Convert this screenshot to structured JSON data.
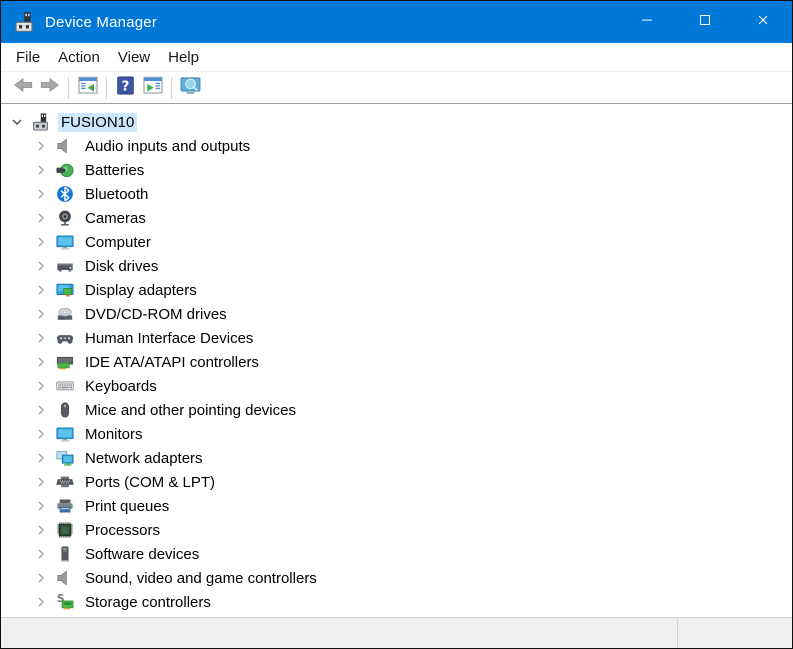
{
  "window": {
    "title": "Device Manager",
    "icon": "device-manager-icon",
    "controls": [
      {
        "name": "minimize",
        "icon": "minimize-icon"
      },
      {
        "name": "maximize",
        "icon": "maximize-icon"
      },
      {
        "name": "close",
        "icon": "close-icon"
      }
    ]
  },
  "menu_bar": {
    "items": [
      {
        "label": "File"
      },
      {
        "label": "Action"
      },
      {
        "label": "View"
      },
      {
        "label": "Help"
      }
    ]
  },
  "toolbar": {
    "buttons": [
      {
        "name": "back",
        "icon": "back-arrow-icon",
        "disabled": true
      },
      {
        "name": "forward",
        "icon": "forward-arrow-icon",
        "disabled": true
      },
      {
        "name": "show-console-tree",
        "icon": "console-tree-icon"
      },
      {
        "name": "help",
        "icon": "help-icon"
      },
      {
        "name": "export-list",
        "icon": "export-list-icon"
      },
      {
        "name": "scan-hardware-changes",
        "icon": "scan-hardware-icon"
      }
    ]
  },
  "tree": {
    "root": {
      "label": "FUSION10",
      "icon": "computer-root-icon",
      "expanded": true,
      "selected": true
    },
    "items": [
      {
        "label": "Audio inputs and outputs",
        "icon": "speaker-icon"
      },
      {
        "label": "Batteries",
        "icon": "battery-icon"
      },
      {
        "label": "Bluetooth",
        "icon": "bluetooth-icon"
      },
      {
        "label": "Cameras",
        "icon": "camera-icon"
      },
      {
        "label": "Computer",
        "icon": "monitor-icon"
      },
      {
        "label": "Disk drives",
        "icon": "disk-drive-icon"
      },
      {
        "label": "Display adapters",
        "icon": "display-adapter-icon"
      },
      {
        "label": "DVD/CD-ROM drives",
        "icon": "dvd-drive-icon"
      },
      {
        "label": "Human Interface Devices",
        "icon": "gamepad-icon"
      },
      {
        "label": "IDE ATA/ATAPI controllers",
        "icon": "ide-controller-icon"
      },
      {
        "label": "Keyboards",
        "icon": "keyboard-icon"
      },
      {
        "label": "Mice and other pointing devices",
        "icon": "mouse-icon"
      },
      {
        "label": "Monitors",
        "icon": "monitor-icon"
      },
      {
        "label": "Network adapters",
        "icon": "network-adapter-icon"
      },
      {
        "label": "Ports (COM & LPT)",
        "icon": "serial-port-icon"
      },
      {
        "label": "Print queues",
        "icon": "printer-icon"
      },
      {
        "label": "Processors",
        "icon": "processor-icon"
      },
      {
        "label": "Software devices",
        "icon": "software-device-icon"
      },
      {
        "label": "Sound, video and game controllers",
        "icon": "speaker-icon"
      },
      {
        "label": "Storage controllers",
        "icon": "storage-controller-icon"
      }
    ],
    "partial_next_item": {
      "label": "",
      "icon": "system-devices-icon"
    }
  },
  "status_bar": {
    "left_text": "",
    "right_text": ""
  },
  "colors": {
    "titlebar": "#0078d7",
    "selection": "#cce8ff",
    "statusbar": "#f0f0f0",
    "accent_green": "#3fae49",
    "help_blue": "#3d55a6"
  }
}
